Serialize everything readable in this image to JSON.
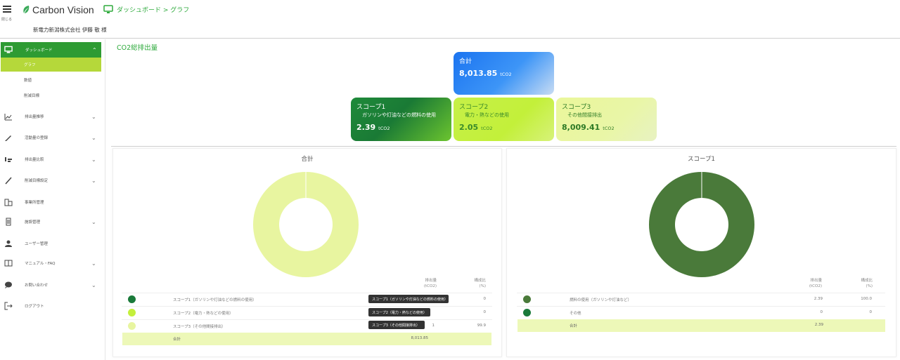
{
  "header": {
    "menu_caption": "閉じる",
    "app_name": "Carbon Vision",
    "breadcrumb": "ダッシュボード > グラフ",
    "org_name": "新電力新潟株式会社 伊藤 敬 様"
  },
  "sidebar": {
    "items": [
      {
        "label": "ダッシュボード",
        "icon": "monitor-icon"
      },
      {
        "label": "排出量推移",
        "icon": "line-chart-icon"
      },
      {
        "label": "活動量の登録",
        "icon": "pencil-icon"
      },
      {
        "label": "排出量比較",
        "icon": "bar-sort-icon"
      },
      {
        "label": "削減目標設定",
        "icon": "pen-icon"
      },
      {
        "label": "事業所管理",
        "icon": "buildings-icon"
      },
      {
        "label": "施設管理",
        "icon": "building-icon"
      },
      {
        "label": "ユーザー管理",
        "icon": "user-icon"
      },
      {
        "label": "マニュアル・FAQ",
        "icon": "book-icon"
      },
      {
        "label": "お問い合わせ",
        "icon": "chat-icon"
      },
      {
        "label": "ログアウト",
        "icon": "logout-icon"
      }
    ],
    "sub_items": [
      {
        "label": "グラフ"
      },
      {
        "label": "数値"
      },
      {
        "label": "削減目標"
      }
    ]
  },
  "main": {
    "title": "CO2総排出量"
  },
  "cards": {
    "total": {
      "title": "合計",
      "value": "8,013.85",
      "unit": "tCO2",
      "color": "#1b74f0"
    },
    "scope1": {
      "title": "スコープ1",
      "subtitle": "ガソリンや灯油などの燃料の使用",
      "value": "2.39",
      "unit": "tCO2",
      "color": "#1a7a35"
    },
    "scope2": {
      "title": "スコープ2",
      "subtitle": "電力・熱などの使用",
      "value": "2.05",
      "unit": "tCO2",
      "color": "#c3f03a"
    },
    "scope3": {
      "title": "スコープ3",
      "subtitle": "その他間接排出",
      "value": "8,009.41",
      "unit": "tCO2",
      "color": "#e9f6a7"
    }
  },
  "left_panel": {
    "title": "合計",
    "col1_head": "排出量",
    "col1_unit": "(tCO2)",
    "col2_head": "構成比",
    "col2_unit": "(%)",
    "rows": [
      {
        "name": "スコープ1（ガソリンや灯油などの燃料の使用）",
        "v1": "",
        "v2": "0",
        "color": "#1a7a3a"
      },
      {
        "name": "スコープ2（電力・熱などの使用）",
        "v1": "",
        "v2": "0",
        "color": "#c4f03c"
      },
      {
        "name": "スコープ3（その他間接排出）",
        "v1": "1",
        "v2": "99.9",
        "color": "#e8f5a0"
      }
    ],
    "tooltips": [
      "スコープ1（ガソリンや灯油などの燃料の使用）",
      "スコープ2（電力・熱などの使用）",
      "スコープ3（その他間接排出）"
    ],
    "total_label": "合計",
    "total_value": "8,013.85"
  },
  "right_panel": {
    "title": "スコープ1",
    "col1_head": "排出量",
    "col1_unit": "(tCO2)",
    "col2_head": "構成比",
    "col2_unit": "(%)",
    "rows": [
      {
        "name": "燃料の使用（ガソリンや灯油など）",
        "v1": "2.39",
        "v2": "100.0",
        "color": "#4a7a3a"
      },
      {
        "name": "その他",
        "v1": "0",
        "v2": "0",
        "color": "#1a7a3a"
      }
    ],
    "total_label": "合計",
    "total_value": "2.39"
  },
  "chart_data": [
    {
      "type": "pie",
      "title": "合計",
      "categories": [
        "スコープ1",
        "スコープ2",
        "スコープ3"
      ],
      "values": [
        2.39,
        2.05,
        8009.41
      ],
      "colors": [
        "#1a7a3a",
        "#c4f03c",
        "#e8f5a0"
      ]
    },
    {
      "type": "pie",
      "title": "スコープ1",
      "categories": [
        "燃料の使用（ガソリンや灯油など）",
        "その他"
      ],
      "values": [
        2.39,
        0
      ],
      "colors": [
        "#4a7a3a",
        "#1a7a3a"
      ]
    }
  ]
}
